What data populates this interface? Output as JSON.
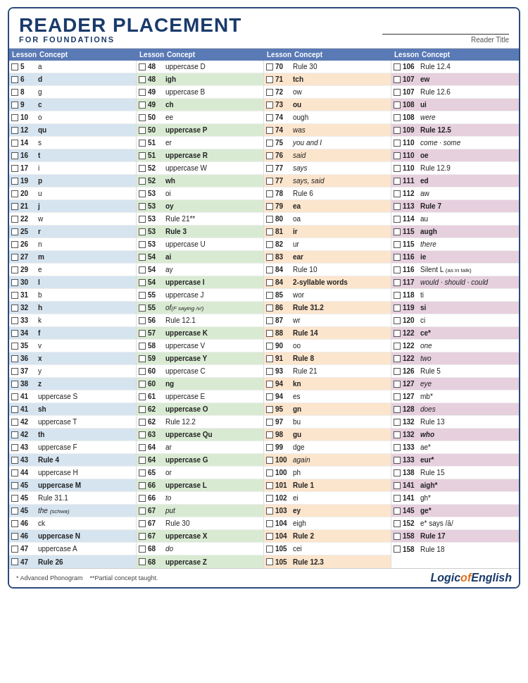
{
  "header": {
    "title": "READER PLACEMENT",
    "subtitle": "FOR FOUNDATIONS",
    "reader_title_label": "Reader Title"
  },
  "col_headers": [
    {
      "lesson": "Lesson",
      "concept": "Concept"
    },
    {
      "lesson": "Lesson",
      "concept": "Concept"
    },
    {
      "lesson": "Lesson",
      "concept": "Concept"
    },
    {
      "lesson": "Lesson",
      "concept": "Concept"
    }
  ],
  "columns": [
    [
      {
        "num": "5",
        "concept": "a",
        "shade": ""
      },
      {
        "num": "6",
        "concept": "d",
        "shade": "shaded",
        "bold": true
      },
      {
        "num": "8",
        "concept": "g",
        "shade": ""
      },
      {
        "num": "9",
        "concept": "c",
        "shade": "shaded",
        "bold": true
      },
      {
        "num": "10",
        "concept": "o",
        "shade": ""
      },
      {
        "num": "12",
        "concept": "qu",
        "shade": "shaded",
        "bold": true
      },
      {
        "num": "14",
        "concept": "s",
        "shade": ""
      },
      {
        "num": "16",
        "concept": "t",
        "shade": "shaded",
        "bold": true
      },
      {
        "num": "17",
        "concept": "i",
        "shade": ""
      },
      {
        "num": "19",
        "concept": "p",
        "shade": "shaded",
        "bold": true
      },
      {
        "num": "20",
        "concept": "u",
        "shade": ""
      },
      {
        "num": "21",
        "concept": "j",
        "shade": "shaded",
        "bold": true
      },
      {
        "num": "22",
        "concept": "w",
        "shade": ""
      },
      {
        "num": "25",
        "concept": "r",
        "shade": "shaded",
        "bold": true
      },
      {
        "num": "26",
        "concept": "n",
        "shade": ""
      },
      {
        "num": "27",
        "concept": "m",
        "shade": "shaded",
        "bold": true
      },
      {
        "num": "29",
        "concept": "e",
        "shade": ""
      },
      {
        "num": "30",
        "concept": "l",
        "shade": "shaded",
        "bold": true
      },
      {
        "num": "31",
        "concept": "b",
        "shade": ""
      },
      {
        "num": "32",
        "concept": "h",
        "shade": "shaded",
        "bold": true
      },
      {
        "num": "33",
        "concept": "k",
        "shade": ""
      },
      {
        "num": "34",
        "concept": "f",
        "shade": "shaded",
        "bold": true
      },
      {
        "num": "35",
        "concept": "v",
        "shade": ""
      },
      {
        "num": "36",
        "concept": "x",
        "shade": "shaded",
        "bold": true
      },
      {
        "num": "37",
        "concept": "y",
        "shade": ""
      },
      {
        "num": "38",
        "concept": "z",
        "shade": "shaded",
        "bold": true
      },
      {
        "num": "41",
        "concept": "uppercase S",
        "shade": ""
      },
      {
        "num": "41",
        "concept": "sh",
        "shade": "shaded",
        "bold": true
      },
      {
        "num": "42",
        "concept": "uppercase T",
        "shade": ""
      },
      {
        "num": "42",
        "concept": "th",
        "shade": "shaded",
        "bold": true
      },
      {
        "num": "43",
        "concept": "uppercase F",
        "shade": ""
      },
      {
        "num": "43",
        "concept": "Rule 4",
        "shade": "shaded",
        "bold": true
      },
      {
        "num": "44",
        "concept": "uppercase H",
        "shade": ""
      },
      {
        "num": "45",
        "concept": "uppercase M",
        "shade": "shaded",
        "bold": true
      },
      {
        "num": "45",
        "concept": "Rule 31.1",
        "shade": ""
      },
      {
        "num": "45",
        "concept": "the (schwa)",
        "shade": "shaded",
        "italic": true
      },
      {
        "num": "46",
        "concept": "ck",
        "shade": ""
      },
      {
        "num": "46",
        "concept": "uppercase N",
        "shade": "shaded",
        "bold": true
      },
      {
        "num": "47",
        "concept": "uppercase A",
        "shade": ""
      },
      {
        "num": "47",
        "concept": "Rule 26",
        "shade": "shaded",
        "bold": true
      }
    ],
    [
      {
        "num": "48",
        "concept": "uppercase D",
        "shade": ""
      },
      {
        "num": "48",
        "concept": "igh",
        "shade": "shaded-green",
        "bold": true
      },
      {
        "num": "49",
        "concept": "uppercase B",
        "shade": ""
      },
      {
        "num": "49",
        "concept": "ch",
        "shade": "shaded-green",
        "bold": true
      },
      {
        "num": "50",
        "concept": "ee",
        "shade": ""
      },
      {
        "num": "50",
        "concept": "uppercase P",
        "shade": "shaded-green",
        "bold": true
      },
      {
        "num": "51",
        "concept": "er",
        "shade": ""
      },
      {
        "num": "51",
        "concept": "uppercase R",
        "shade": "shaded-green",
        "bold": true
      },
      {
        "num": "52",
        "concept": "uppercase W",
        "shade": ""
      },
      {
        "num": "52",
        "concept": "wh",
        "shade": "shaded-green",
        "bold": true
      },
      {
        "num": "53",
        "concept": "oi",
        "shade": ""
      },
      {
        "num": "53",
        "concept": "oy",
        "shade": "shaded-green",
        "bold": true
      },
      {
        "num": "53",
        "concept": "Rule 21**",
        "shade": ""
      },
      {
        "num": "53",
        "concept": "Rule 3",
        "shade": "shaded-green",
        "bold": true
      },
      {
        "num": "53",
        "concept": "uppercase U",
        "shade": ""
      },
      {
        "num": "54",
        "concept": "ai",
        "shade": "shaded-green",
        "bold": true
      },
      {
        "num": "54",
        "concept": "ay",
        "shade": ""
      },
      {
        "num": "54",
        "concept": "uppercase I",
        "shade": "shaded-green",
        "bold": true
      },
      {
        "num": "55",
        "concept": "uppercase J",
        "shade": ""
      },
      {
        "num": "55",
        "concept": "of (F saying /v/)",
        "shade": "shaded-green",
        "italic": true
      },
      {
        "num": "56",
        "concept": "Rule 12.1",
        "shade": ""
      },
      {
        "num": "57",
        "concept": "uppercase K",
        "shade": "shaded-green",
        "bold": true
      },
      {
        "num": "58",
        "concept": "uppercase V",
        "shade": ""
      },
      {
        "num": "59",
        "concept": "uppercase Y",
        "shade": "shaded-green",
        "bold": true
      },
      {
        "num": "60",
        "concept": "uppercase C",
        "shade": ""
      },
      {
        "num": "60",
        "concept": "ng",
        "shade": "shaded-green",
        "bold": true
      },
      {
        "num": "61",
        "concept": "uppercase E",
        "shade": ""
      },
      {
        "num": "62",
        "concept": "uppercase O",
        "shade": "shaded-green",
        "bold": true
      },
      {
        "num": "62",
        "concept": "Rule 12.2",
        "shade": ""
      },
      {
        "num": "63",
        "concept": "uppercase Qu",
        "shade": "shaded-green",
        "bold": true
      },
      {
        "num": "64",
        "concept": "ar",
        "shade": ""
      },
      {
        "num": "64",
        "concept": "uppercase G",
        "shade": "shaded-green",
        "bold": true
      },
      {
        "num": "65",
        "concept": "or",
        "shade": ""
      },
      {
        "num": "66",
        "concept": "uppercase L",
        "shade": "shaded-green",
        "bold": true
      },
      {
        "num": "66",
        "concept": "to",
        "shade": "",
        "italic": true
      },
      {
        "num": "67",
        "concept": "put",
        "shade": "shaded-green",
        "italic": true
      },
      {
        "num": "67",
        "concept": "Rule 30",
        "shade": ""
      },
      {
        "num": "67",
        "concept": "uppercase X",
        "shade": "shaded-green",
        "bold": true
      },
      {
        "num": "68",
        "concept": "do",
        "shade": "",
        "italic": true
      },
      {
        "num": "68",
        "concept": "uppercase Z",
        "shade": "shaded-green",
        "bold": true
      }
    ],
    [
      {
        "num": "70",
        "concept": "Rule 30",
        "shade": ""
      },
      {
        "num": "71",
        "concept": "tch",
        "shade": "shaded-peach",
        "bold": true
      },
      {
        "num": "72",
        "concept": "ow",
        "shade": ""
      },
      {
        "num": "73",
        "concept": "ou",
        "shade": "shaded-peach",
        "bold": true
      },
      {
        "num": "74",
        "concept": "ough",
        "shade": ""
      },
      {
        "num": "74",
        "concept": "was",
        "shade": "shaded-peach",
        "italic": true
      },
      {
        "num": "75",
        "concept": "you and I",
        "shade": "",
        "italic": true
      },
      {
        "num": "76",
        "concept": "said",
        "shade": "shaded-peach",
        "italic": true
      },
      {
        "num": "77",
        "concept": "says",
        "shade": "",
        "italic": true
      },
      {
        "num": "77",
        "concept": "says, said",
        "shade": "shaded-peach",
        "italic": true
      },
      {
        "num": "78",
        "concept": "Rule 6",
        "shade": ""
      },
      {
        "num": "79",
        "concept": "ea",
        "shade": "shaded-peach",
        "bold": true
      },
      {
        "num": "80",
        "concept": "oa",
        "shade": ""
      },
      {
        "num": "81",
        "concept": "ir",
        "shade": "shaded-peach",
        "bold": true
      },
      {
        "num": "82",
        "concept": "ur",
        "shade": ""
      },
      {
        "num": "83",
        "concept": "ear",
        "shade": "shaded-peach",
        "bold": true
      },
      {
        "num": "84",
        "concept": "Rule 10",
        "shade": ""
      },
      {
        "num": "84",
        "concept": "2-syllable words",
        "shade": "shaded-peach",
        "bold": true
      },
      {
        "num": "85",
        "concept": "wor",
        "shade": ""
      },
      {
        "num": "86",
        "concept": "Rule 31.2",
        "shade": "shaded-peach",
        "bold": true
      },
      {
        "num": "87",
        "concept": "wr",
        "shade": ""
      },
      {
        "num": "88",
        "concept": "Rule 14",
        "shade": "shaded-peach",
        "bold": true
      },
      {
        "num": "90",
        "concept": "oo",
        "shade": ""
      },
      {
        "num": "91",
        "concept": "Rule 8",
        "shade": "shaded-peach",
        "bold": true
      },
      {
        "num": "93",
        "concept": "Rule 21",
        "shade": ""
      },
      {
        "num": "94",
        "concept": "kn",
        "shade": "shaded-peach",
        "bold": true
      },
      {
        "num": "94",
        "concept": "es",
        "shade": ""
      },
      {
        "num": "95",
        "concept": "gn",
        "shade": "shaded-peach",
        "bold": true
      },
      {
        "num": "97",
        "concept": "bu",
        "shade": ""
      },
      {
        "num": "98",
        "concept": "gu",
        "shade": "shaded-peach",
        "bold": true
      },
      {
        "num": "99",
        "concept": "dge",
        "shade": ""
      },
      {
        "num": "100",
        "concept": "again",
        "shade": "shaded-peach",
        "italic": true
      },
      {
        "num": "100",
        "concept": "ph",
        "shade": ""
      },
      {
        "num": "101",
        "concept": "Rule 1",
        "shade": "shaded-peach",
        "bold": true
      },
      {
        "num": "102",
        "concept": "ei",
        "shade": ""
      },
      {
        "num": "103",
        "concept": "ey",
        "shade": "shaded-peach",
        "bold": true
      },
      {
        "num": "104",
        "concept": "eigh",
        "shade": ""
      },
      {
        "num": "104",
        "concept": "Rule 2",
        "shade": "shaded-peach",
        "bold": true
      },
      {
        "num": "105",
        "concept": "cei",
        "shade": ""
      },
      {
        "num": "105",
        "concept": "Rule 12.3",
        "shade": "shaded-peach",
        "bold": true
      }
    ],
    [
      {
        "num": "106",
        "concept": "Rule 12.4",
        "shade": ""
      },
      {
        "num": "107",
        "concept": "ew",
        "shade": "shaded-lavender",
        "bold": true
      },
      {
        "num": "107",
        "concept": "Rule 12.6",
        "shade": ""
      },
      {
        "num": "108",
        "concept": "ui",
        "shade": "shaded-lavender",
        "bold": true
      },
      {
        "num": "108",
        "concept": "were",
        "shade": "",
        "italic": true
      },
      {
        "num": "109",
        "concept": "Rule 12.5",
        "shade": "shaded-lavender",
        "bold": true
      },
      {
        "num": "110",
        "concept": "come · some",
        "shade": "",
        "italic": true
      },
      {
        "num": "110",
        "concept": "oe",
        "shade": "shaded-lavender",
        "bold": true
      },
      {
        "num": "110",
        "concept": "Rule 12.9",
        "shade": ""
      },
      {
        "num": "111",
        "concept": "ed",
        "shade": "shaded-lavender",
        "bold": true
      },
      {
        "num": "112",
        "concept": "aw",
        "shade": ""
      },
      {
        "num": "113",
        "concept": "Rule 7",
        "shade": "shaded-lavender",
        "bold": true
      },
      {
        "num": "114",
        "concept": "au",
        "shade": ""
      },
      {
        "num": "115",
        "concept": "augh",
        "shade": "shaded-lavender",
        "bold": true
      },
      {
        "num": "115",
        "concept": "there",
        "shade": "",
        "italic": true
      },
      {
        "num": "116",
        "concept": "ie",
        "shade": "shaded-lavender",
        "bold": true
      },
      {
        "num": "116",
        "concept": "Silent L (as in talk)",
        "shade": ""
      },
      {
        "num": "117",
        "concept": "would · should · could",
        "shade": "shaded-lavender",
        "italic": true
      },
      {
        "num": "118",
        "concept": "ti",
        "shade": ""
      },
      {
        "num": "119",
        "concept": "si",
        "shade": "shaded-lavender",
        "bold": true
      },
      {
        "num": "120",
        "concept": "ci",
        "shade": ""
      },
      {
        "num": "122",
        "concept": "ce*",
        "shade": "shaded-lavender",
        "bold": true
      },
      {
        "num": "122",
        "concept": "one",
        "shade": "",
        "italic": true
      },
      {
        "num": "122",
        "concept": "two",
        "shade": "shaded-lavender",
        "italic": true
      },
      {
        "num": "126",
        "concept": "Rule 5",
        "shade": ""
      },
      {
        "num": "127",
        "concept": "eye",
        "shade": "shaded-lavender",
        "italic": true
      },
      {
        "num": "127",
        "concept": "mb*",
        "shade": ""
      },
      {
        "num": "128",
        "concept": "does",
        "shade": "shaded-lavender",
        "italic": true
      },
      {
        "num": "132",
        "concept": "Rule 13",
        "shade": ""
      },
      {
        "num": "132",
        "concept": "who",
        "shade": "shaded-lavender",
        "bold-italic": true
      },
      {
        "num": "133",
        "concept": "ae*",
        "shade": ""
      },
      {
        "num": "133",
        "concept": "eur*",
        "shade": "shaded-lavender",
        "bold": true
      },
      {
        "num": "138",
        "concept": "Rule 15",
        "shade": ""
      },
      {
        "num": "141",
        "concept": "aigh*",
        "shade": "shaded-lavender",
        "bold": true
      },
      {
        "num": "141",
        "concept": "gh*",
        "shade": ""
      },
      {
        "num": "145",
        "concept": "ge*",
        "shade": "shaded-lavender",
        "bold": true
      },
      {
        "num": "152",
        "concept": "e* says /ā/",
        "shade": ""
      },
      {
        "num": "158",
        "concept": "Rule 17",
        "shade": "shaded-lavender",
        "bold": true
      },
      {
        "num": "158",
        "concept": "Rule 18",
        "shade": ""
      }
    ]
  ],
  "footer": {
    "note1": "* Advanced Phonogram",
    "note2": "**Partial concept taught.",
    "logo": "LogicofEnglish"
  }
}
